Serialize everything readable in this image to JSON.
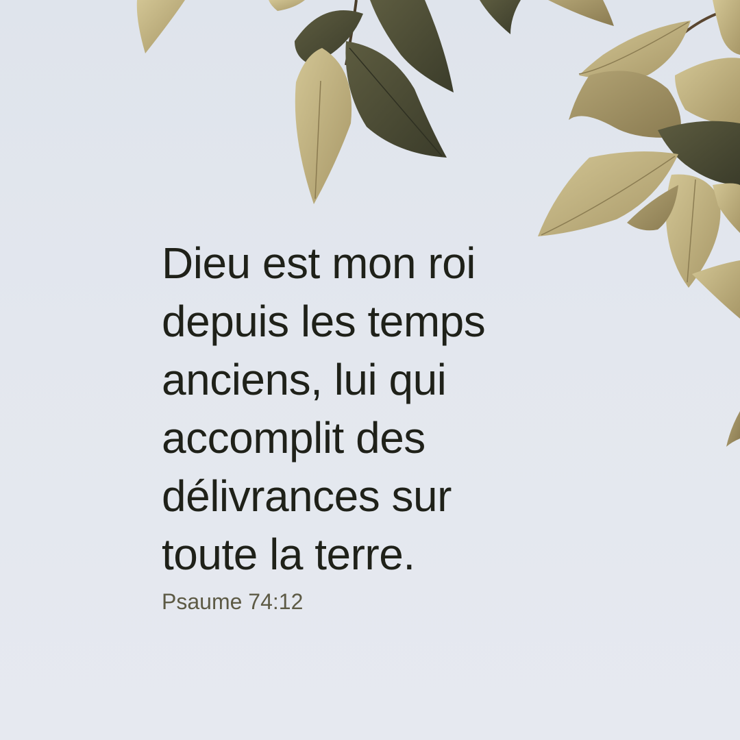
{
  "verse": {
    "lines": [
      "Dieu est mon roi",
      "depuis les temps",
      "anciens, lui qui",
      "accomplit des",
      "délivrances sur",
      "toute la terre."
    ],
    "reference": "Psaume 74:12"
  },
  "colors": {
    "background": "#e3e7ee",
    "text": "#1f2119",
    "reference": "#5d5a45",
    "leaf_light": "#c2b486",
    "leaf_dark": "#4c4d36"
  },
  "icons": [
    "leaves-illustration"
  ]
}
